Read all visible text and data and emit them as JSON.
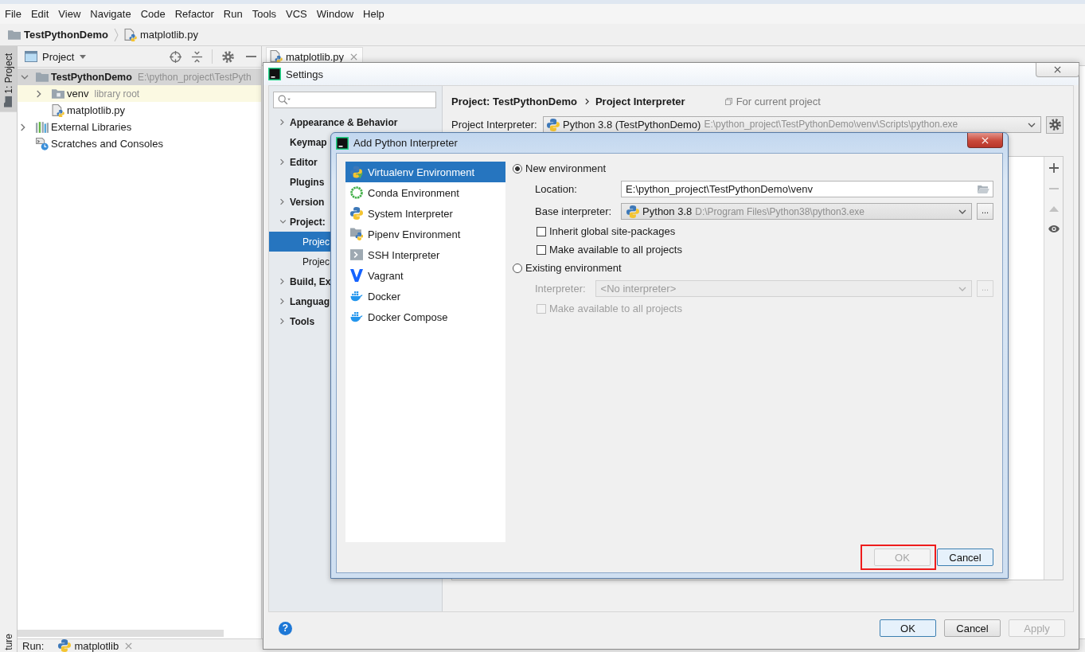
{
  "menu_bar": [
    "File",
    "Edit",
    "View",
    "Navigate",
    "Code",
    "Refactor",
    "Run",
    "Tools",
    "VCS",
    "Window",
    "Help"
  ],
  "breadcrumb": [
    {
      "kind": "folder",
      "label": "TestPythonDemo"
    },
    {
      "kind": "python-file",
      "label": "matplotlib.py"
    }
  ],
  "tool_strip": [
    {
      "kind": "folder",
      "label": "1: Project",
      "selected": true
    },
    {
      "kind": "structure",
      "label": "ture",
      "selected": false
    }
  ],
  "project_panel": {
    "title": "Project",
    "tree": [
      {
        "kind": "project-folder",
        "label": "TestPythonDemo",
        "detail": "E:\\python_project\\TestPyth",
        "expanded": true,
        "selected": true,
        "children": [
          {
            "kind": "library-folder",
            "label": "venv",
            "detail": "library root",
            "expanded": false,
            "selected": false
          },
          {
            "kind": "python-file",
            "label": "matplotlib.py",
            "selected": false
          }
        ]
      },
      {
        "kind": "libraries",
        "label": "External Libraries",
        "expanded": false,
        "selected": false
      },
      {
        "kind": "scratches",
        "label": "Scratches and Consoles",
        "selected": false
      }
    ]
  },
  "editor_tabs": [
    {
      "label": "matplotlib.py",
      "selected": true
    }
  ],
  "run_bar": {
    "label": "Run:",
    "tab": "matplotlib"
  },
  "settings": {
    "title": "Settings",
    "nav": [
      {
        "label": "Appearance & Behavior",
        "expanded": false,
        "selected": false
      },
      {
        "label": "Keymap",
        "selected": false
      },
      {
        "label": "Editor",
        "expanded": false,
        "selected": false
      },
      {
        "label": "Plugins",
        "selected": false
      },
      {
        "label": "Version",
        "expanded": false,
        "selected": false
      },
      {
        "label": "Project:",
        "expanded": true,
        "selected": false,
        "children": [
          {
            "label": "Projec",
            "selected": true
          },
          {
            "label": "Projec",
            "selected": false
          }
        ]
      },
      {
        "label": "Build, Ex",
        "expanded": false,
        "selected": false
      },
      {
        "label": "Languag",
        "expanded": false,
        "selected": false
      },
      {
        "label": "Tools",
        "expanded": false,
        "selected": false
      }
    ],
    "breadcrumb": [
      "Project: TestPythonDemo",
      "Project Interpreter"
    ],
    "scope_note": "For current project",
    "interpreter": {
      "label": "Project Interpreter:",
      "value": "Python 3.8 (TestPythonDemo)",
      "path": "E:\\python_project\\TestPythonDemo\\venv\\Scripts\\python.exe"
    },
    "table_tools": [
      {
        "kind": "add",
        "disabled": false
      },
      {
        "kind": "remove",
        "disabled": true
      },
      {
        "kind": "upgrade",
        "disabled": true
      },
      {
        "kind": "show",
        "disabled": false
      }
    ],
    "help": "?",
    "buttons": [
      {
        "label": "OK",
        "focused": true,
        "disabled": false
      },
      {
        "label": "Cancel",
        "focused": false,
        "disabled": false
      },
      {
        "label": "Apply",
        "focused": false,
        "disabled": true
      }
    ]
  },
  "add_interpreter": {
    "title": "Add Python Interpreter",
    "types": [
      {
        "kind": "virtualenv",
        "label": "Virtualenv Environment",
        "selected": true
      },
      {
        "kind": "conda",
        "label": "Conda Environment",
        "selected": false
      },
      {
        "kind": "system",
        "label": "System Interpreter",
        "selected": false
      },
      {
        "kind": "pipenv",
        "label": "Pipenv Environment",
        "selected": false
      },
      {
        "kind": "ssh",
        "label": "SSH Interpreter",
        "selected": false
      },
      {
        "kind": "vagrant",
        "label": "Vagrant",
        "selected": false
      },
      {
        "kind": "docker",
        "label": "Docker",
        "selected": false
      },
      {
        "kind": "docker-compose",
        "label": "Docker Compose",
        "selected": false
      }
    ],
    "environments": [
      {
        "label": "New environment",
        "selected": true,
        "fields": [
          {
            "kind": "path",
            "label": "Location:",
            "value": "E:\\python_project\\TestPythonDemo\\venv",
            "disabled": false
          },
          {
            "kind": "interpreter",
            "label": "Base interpreter:",
            "value": "Python 3.8",
            "path": "D:\\Program Files\\Python38\\python3.exe",
            "browse": "...",
            "disabled": false
          }
        ],
        "checkboxes": [
          {
            "label": "Inherit global site-packages",
            "checked": false,
            "disabled": false
          },
          {
            "label": "Make available to all projects",
            "checked": false,
            "disabled": false
          }
        ]
      },
      {
        "label": "Existing environment",
        "selected": false,
        "fields": [
          {
            "kind": "interpreter",
            "label": "Interpreter:",
            "value": "<No interpreter>",
            "browse": "...",
            "disabled": true
          }
        ],
        "checkboxes": [
          {
            "label": "Make available to all projects",
            "checked": false,
            "disabled": true
          }
        ]
      }
    ],
    "buttons": [
      {
        "label": "OK",
        "disabled": true,
        "focused": false,
        "highlighted": true
      },
      {
        "label": "Cancel",
        "disabled": false,
        "focused": true,
        "highlighted": false
      }
    ]
  }
}
